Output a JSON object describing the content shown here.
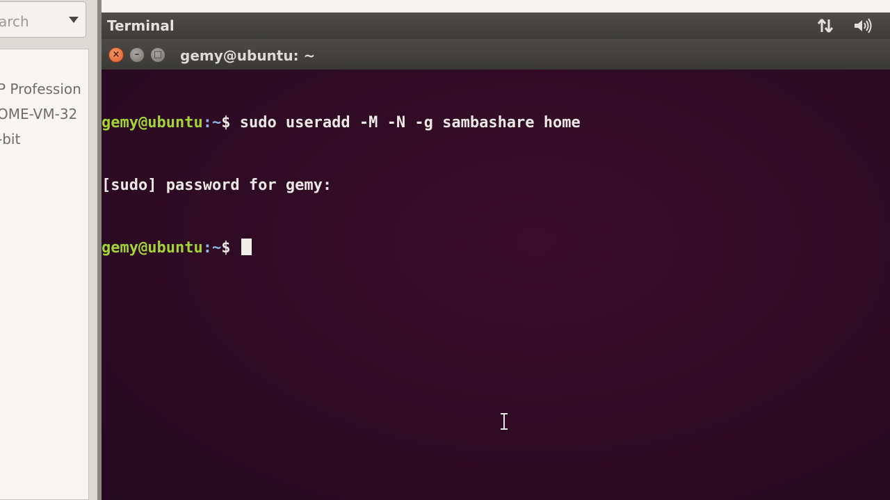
{
  "host": {
    "search_text": "arch",
    "vm_list_lines": [
      "P Profession",
      "OME-VM-32",
      "-bit"
    ]
  },
  "panel": {
    "app_title": "Terminal",
    "network_icon": "network-updown-icon",
    "sound_icon": "sound-volume-icon"
  },
  "window": {
    "title": "gemy@ubuntu: ~",
    "close_glyph": "×",
    "minimize_glyph": "–",
    "maximize_glyph": "□"
  },
  "terminal": {
    "lines": [
      {
        "user": "gemy@ubuntu",
        "path": ":~",
        "symbol": "$ ",
        "text": "sudo useradd -M -N -g sambashare home"
      },
      {
        "output": "[sudo] password for gemy:"
      },
      {
        "user": "gemy@ubuntu",
        "path": ":~",
        "symbol": "$ ",
        "text": ""
      }
    ]
  },
  "colors": {
    "terminal_bg": "#300a24",
    "prompt_user": "#a2d43a",
    "prompt_path": "#8fb4e6",
    "close_button": "#e0582a"
  }
}
